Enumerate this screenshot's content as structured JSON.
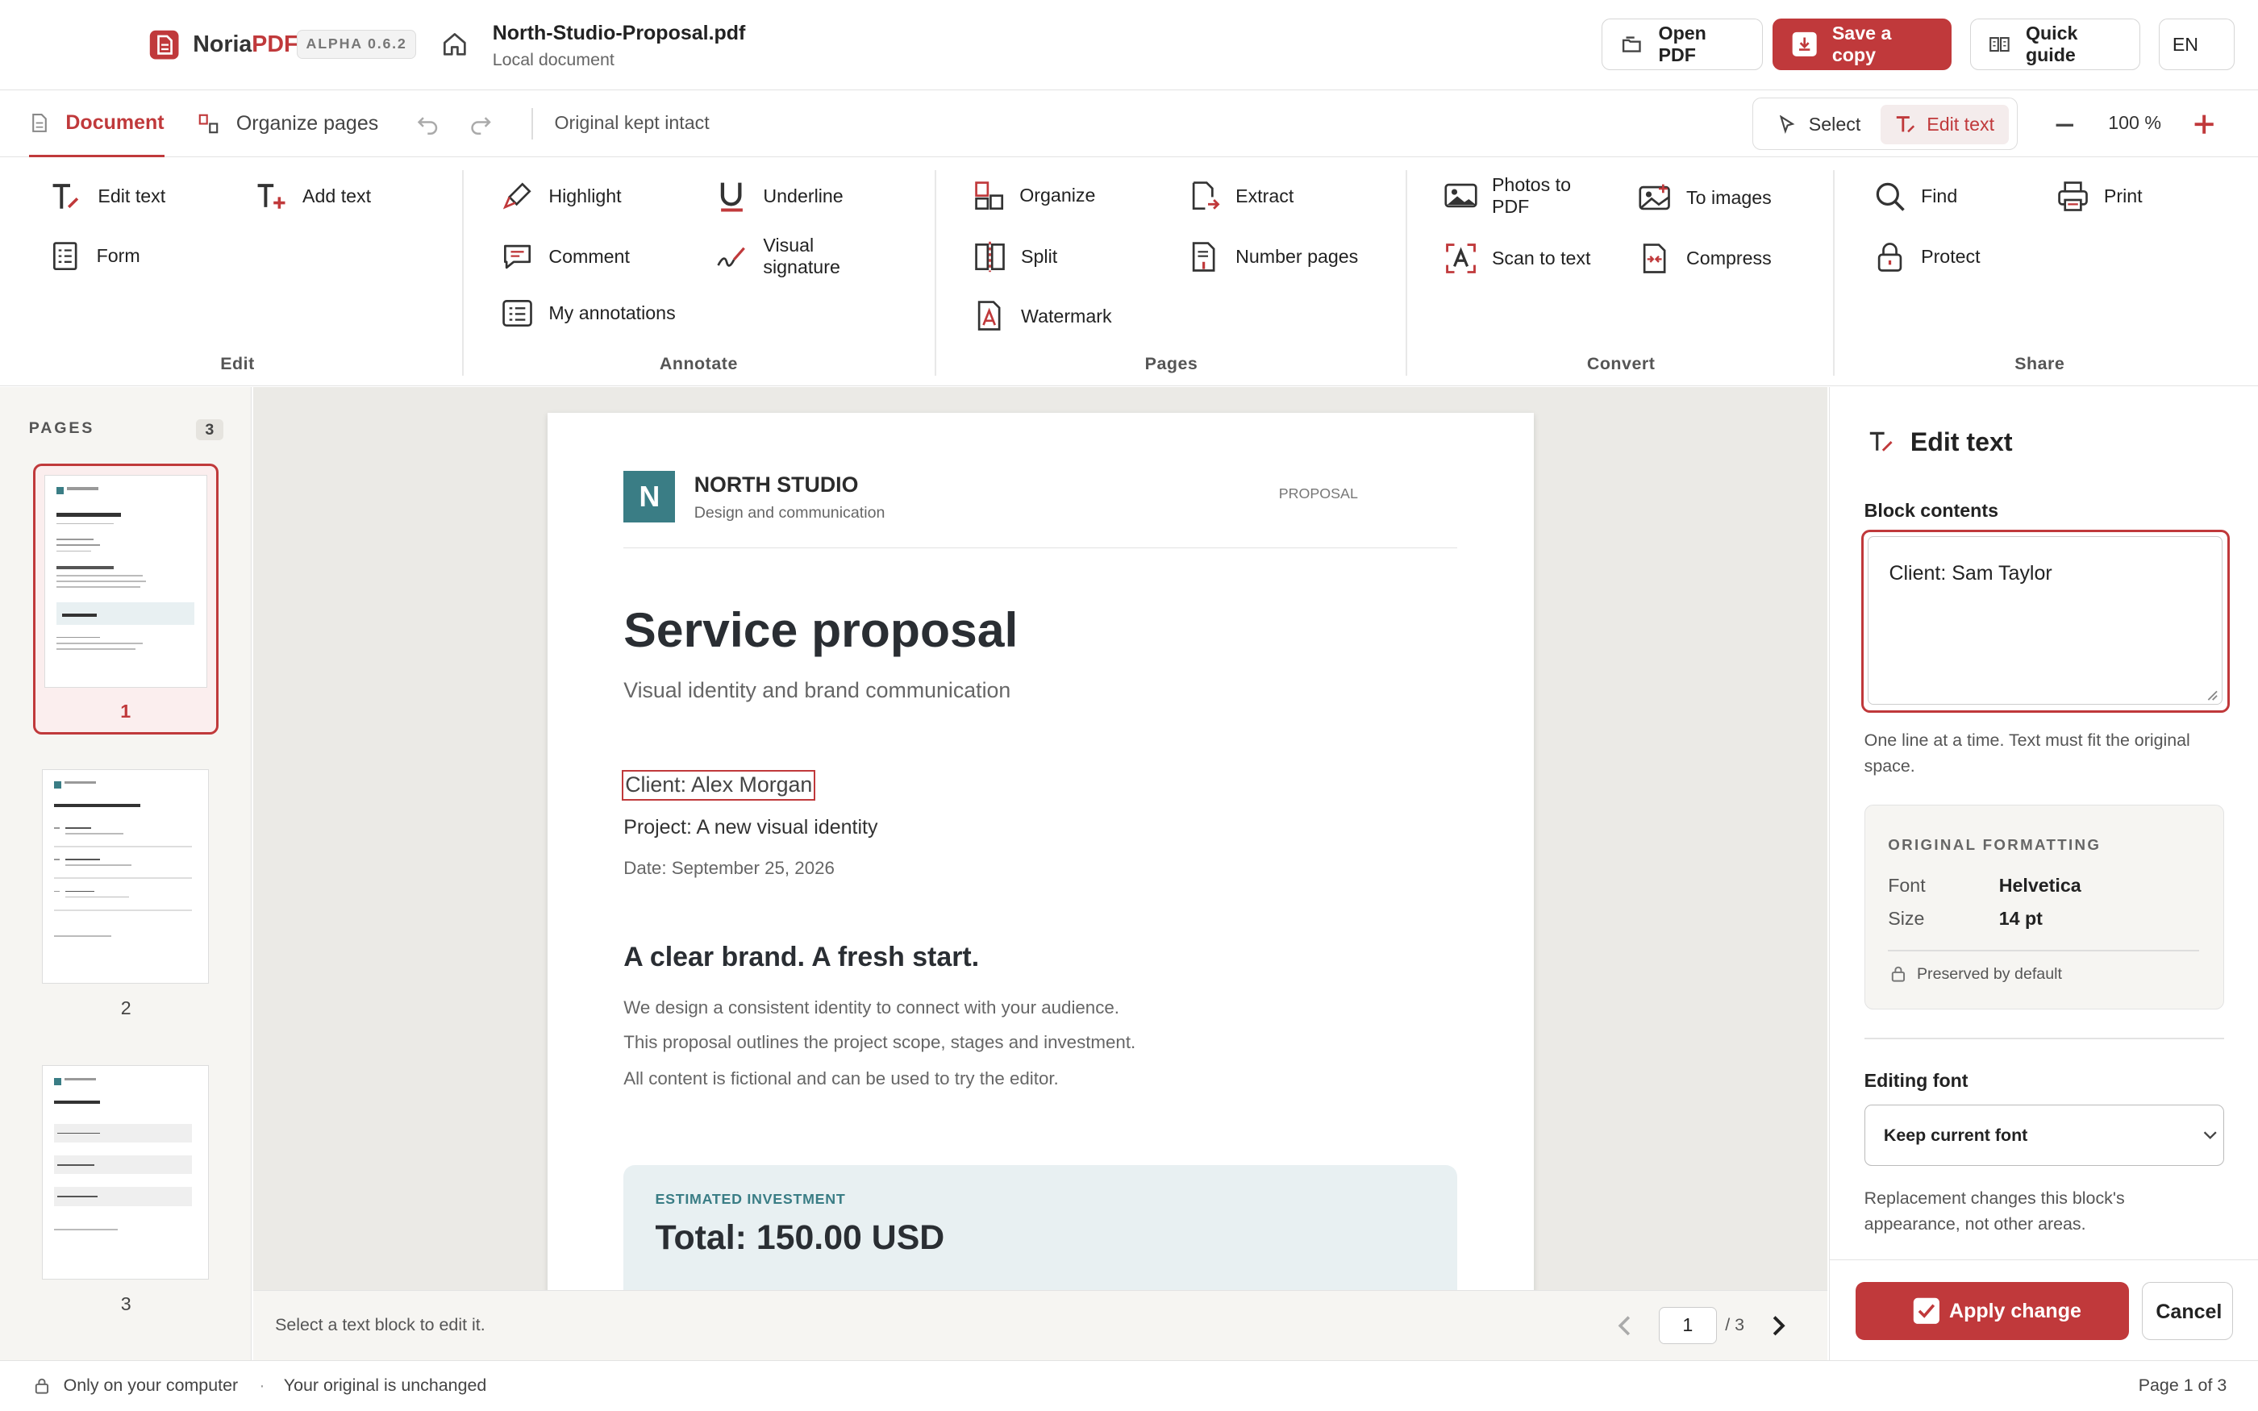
{
  "app": {
    "name_part1": "Noria",
    "name_part2": "PDF",
    "version": "ALPHA 0.6.2"
  },
  "document": {
    "filename": "North-Studio-Proposal.pdf",
    "location": "Local document"
  },
  "header_buttons": {
    "open": "Open PDF",
    "save": "Save a copy",
    "guide": "Quick guide",
    "language": "EN"
  },
  "tabs": [
    {
      "label": "Document"
    },
    {
      "label": "Organize pages"
    }
  ],
  "kept_label": "Original kept intact",
  "modes": {
    "select": "Select",
    "edit": "Edit text"
  },
  "zoom": "100 %",
  "ribbon": {
    "edit": {
      "label": "Edit",
      "items": [
        "Edit text",
        "Add text",
        "Form"
      ]
    },
    "annotate": {
      "label": "Annotate",
      "items": [
        "Highlight",
        "Underline",
        "Comment",
        "Visual signature",
        "My annotations"
      ]
    },
    "pages": {
      "label": "Pages",
      "items": [
        "Organize",
        "Extract",
        "Split",
        "Number pages",
        "Watermark"
      ]
    },
    "convert": {
      "label": "Convert",
      "items": [
        "Photos to PDF",
        "To images",
        "Scan to text",
        "Compress"
      ]
    },
    "share": {
      "label": "Share",
      "items": [
        "Find",
        "Print",
        "Protect"
      ]
    }
  },
  "pages_panel": {
    "label": "PAGES",
    "count": "3",
    "numbers": [
      "1",
      "2",
      "3"
    ]
  },
  "pdf_page": {
    "logo_letter": "N",
    "studio": "NORTH STUDIO",
    "studio_sub": "Design and communication",
    "tag": "PROPOSAL",
    "title": "Service proposal",
    "subtitle": "Visual identity and brand communication",
    "client": "Client: Alex Morgan",
    "project": "Project: A new visual identity",
    "date": "Date: September 25, 2026",
    "heading": "A clear brand. A fresh start.",
    "p1": "We design a consistent identity to connect with your audience.",
    "p2": "This proposal outlines the project scope, stages and investment.",
    "p3": "All content is fictional and can be used to try the editor.",
    "invest_label": "ESTIMATED INVESTMENT",
    "total": "Total: 150.00 USD"
  },
  "bottombar": {
    "hint": "Select a text block to edit it.",
    "page_input": "1",
    "page_total": "/ 3"
  },
  "edit_panel": {
    "title": "Edit text",
    "block_label": "Block contents",
    "block_value": "Client: Sam Taylor",
    "help": "One line at a time. Text must fit the original space.",
    "orig_label": "ORIGINAL FORMATTING",
    "font_key": "Font",
    "font_val": "Helvetica",
    "size_key": "Size",
    "size_val": "14 pt",
    "preserved": "Preserved by default",
    "editing_font_label": "Editing font",
    "font_select": "Keep current font",
    "replace_note": "Replacement changes this block's appearance, not other areas.",
    "apply": "Apply change",
    "cancel": "Cancel"
  },
  "status": {
    "left1": "Only on your computer",
    "dot": "·",
    "left2": "Your original is unchanged",
    "right": "Page 1 of 3"
  },
  "colors": {
    "accent": "#c0393b",
    "teal": "#3a7d85",
    "invest_bg": "#e8f0f2"
  }
}
